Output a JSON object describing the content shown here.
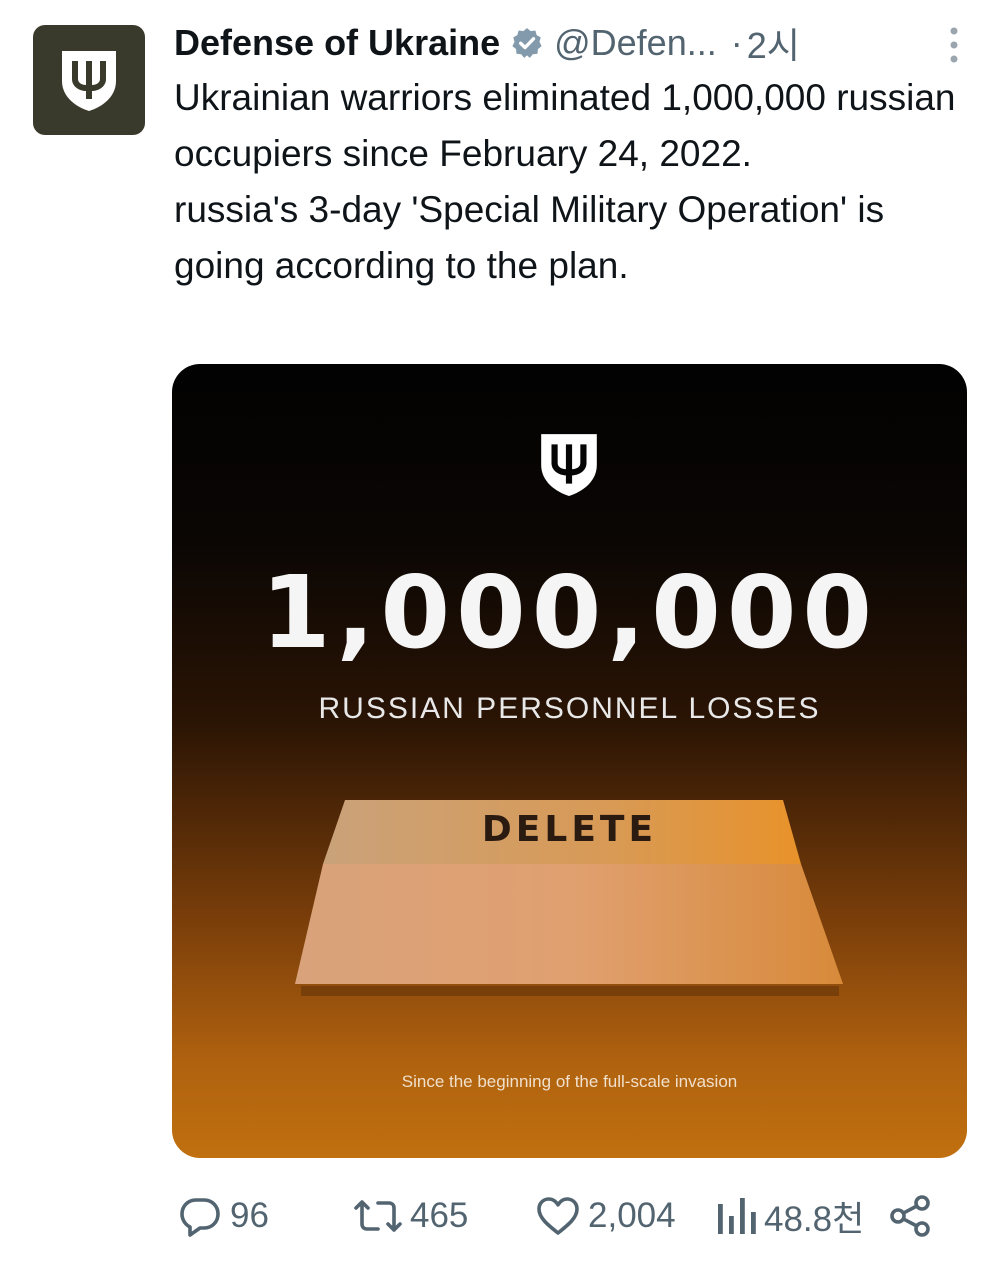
{
  "post": {
    "display_name": "Defense of Ukraine",
    "handle": "@Defen...",
    "separator": "·",
    "time": "2시",
    "text_lines": [
      "Ukrainian warriors eliminated 1,000,000 russian occupiers since February 24, 2022.",
      "russia's 3-day 'Special Military Operation' is going according to the plan."
    ]
  },
  "media": {
    "headline_number": "1,000,000",
    "subtitle": "RUSSIAN PERSONNEL LOSSES",
    "key_label": "DELETE",
    "footnote": "Since the beginning of the full-scale invasion"
  },
  "actions": {
    "replies": "96",
    "reposts": "465",
    "likes": "2,004",
    "views": "48.8천"
  },
  "icons": {
    "avatar": "trident-shield-icon",
    "verified": "verified-badge-icon",
    "more": "more-vertical-icon",
    "reply": "reply-icon",
    "repost": "repost-icon",
    "like": "heart-icon",
    "views": "views-bar-icon",
    "share": "share-icon"
  },
  "colors": {
    "text_primary": "#0f1419",
    "text_secondary": "#536471",
    "avatar_bg": "#3a3a2c",
    "media_accent": "#c0700f"
  }
}
